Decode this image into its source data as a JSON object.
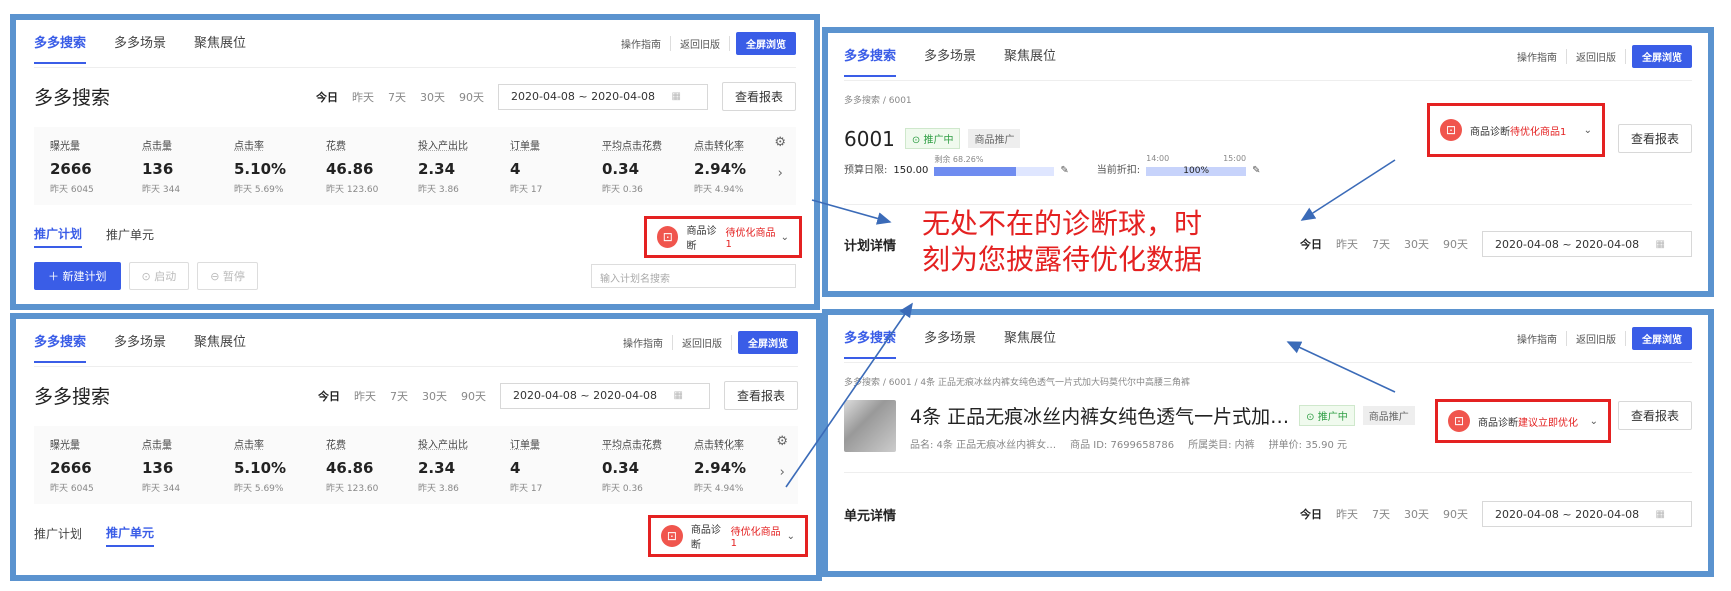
{
  "common": {
    "tabs": [
      "多多搜索",
      "多多场景",
      "聚焦展位"
    ],
    "guide": "操作指南",
    "old": "返回旧版",
    "fullscreen": "全屏浏览",
    "title": "多多搜索",
    "date_tabs": [
      "今日",
      "昨天",
      "7天",
      "30天",
      "90天"
    ],
    "date_range": "2020-04-08 ~ 2020-04-08",
    "report": "查看报表"
  },
  "metrics": [
    {
      "label": "曝光量",
      "value": "2666",
      "sub": "昨天 6045"
    },
    {
      "label": "点击量",
      "value": "136",
      "sub": "昨天 344"
    },
    {
      "label": "点击率",
      "value": "5.10%",
      "sub": "昨天 5.69%"
    },
    {
      "label": "花费",
      "value": "46.86",
      "sub": "昨天 123.60"
    },
    {
      "label": "投入产出比",
      "value": "2.34",
      "sub": "昨天 3.86"
    },
    {
      "label": "订单量",
      "value": "4",
      "sub": "昨天 17"
    },
    {
      "label": "平均点击花费",
      "value": "0.34",
      "sub": "昨天 0.36"
    },
    {
      "label": "点击转化率",
      "value": "2.94%",
      "sub": "昨天 4.94%"
    }
  ],
  "subtabs": [
    "推广计划",
    "推广单元"
  ],
  "diag": {
    "label": "商品诊断",
    "pending": "待优化商品1",
    "suggest": "建议立即优化"
  },
  "toolbar": {
    "new_plan": "＋ 新建计划",
    "start": "⊙ 启动",
    "pause": "⊖ 暂停",
    "search_placeholder": "输入计划名搜索"
  },
  "plan": {
    "crumb": "多多搜索 / 6001",
    "id": "6001",
    "status": "推广中",
    "type": "商品推广",
    "budget_label": "预算日限:",
    "budget_value": "150.00",
    "budget_pct_label": "剩余 68.26%",
    "budget_fill": 0.6826,
    "discount_label": "当前折扣:",
    "discount_value": "100%",
    "time_start": "14:00",
    "time_end": "15:00",
    "detail": "计划详情"
  },
  "unit": {
    "crumb": "多多搜索 / 6001 / 4条 正品无痕冰丝内裤女纯色透气一片式加大码莫代尔中高腰三角裤",
    "title": "4条 正品无痕冰丝内裤女纯色透气一片式加…",
    "status": "推广中",
    "type": "商品推广",
    "meta_name": "品名: 4条 正品无痕冰丝内裤女…",
    "meta_id": "商品 ID: 7699658786",
    "meta_cat": "所属类目: 内裤",
    "meta_price": "拼单价: 35.90 元",
    "detail": "单元详情"
  },
  "annotation": [
    "无处不在的诊断球，时",
    "刻为您披露待优化数据"
  ],
  "colors": {
    "frame": "#5b93cf",
    "accent": "#3a5de7",
    "highlight": "#e42121"
  }
}
